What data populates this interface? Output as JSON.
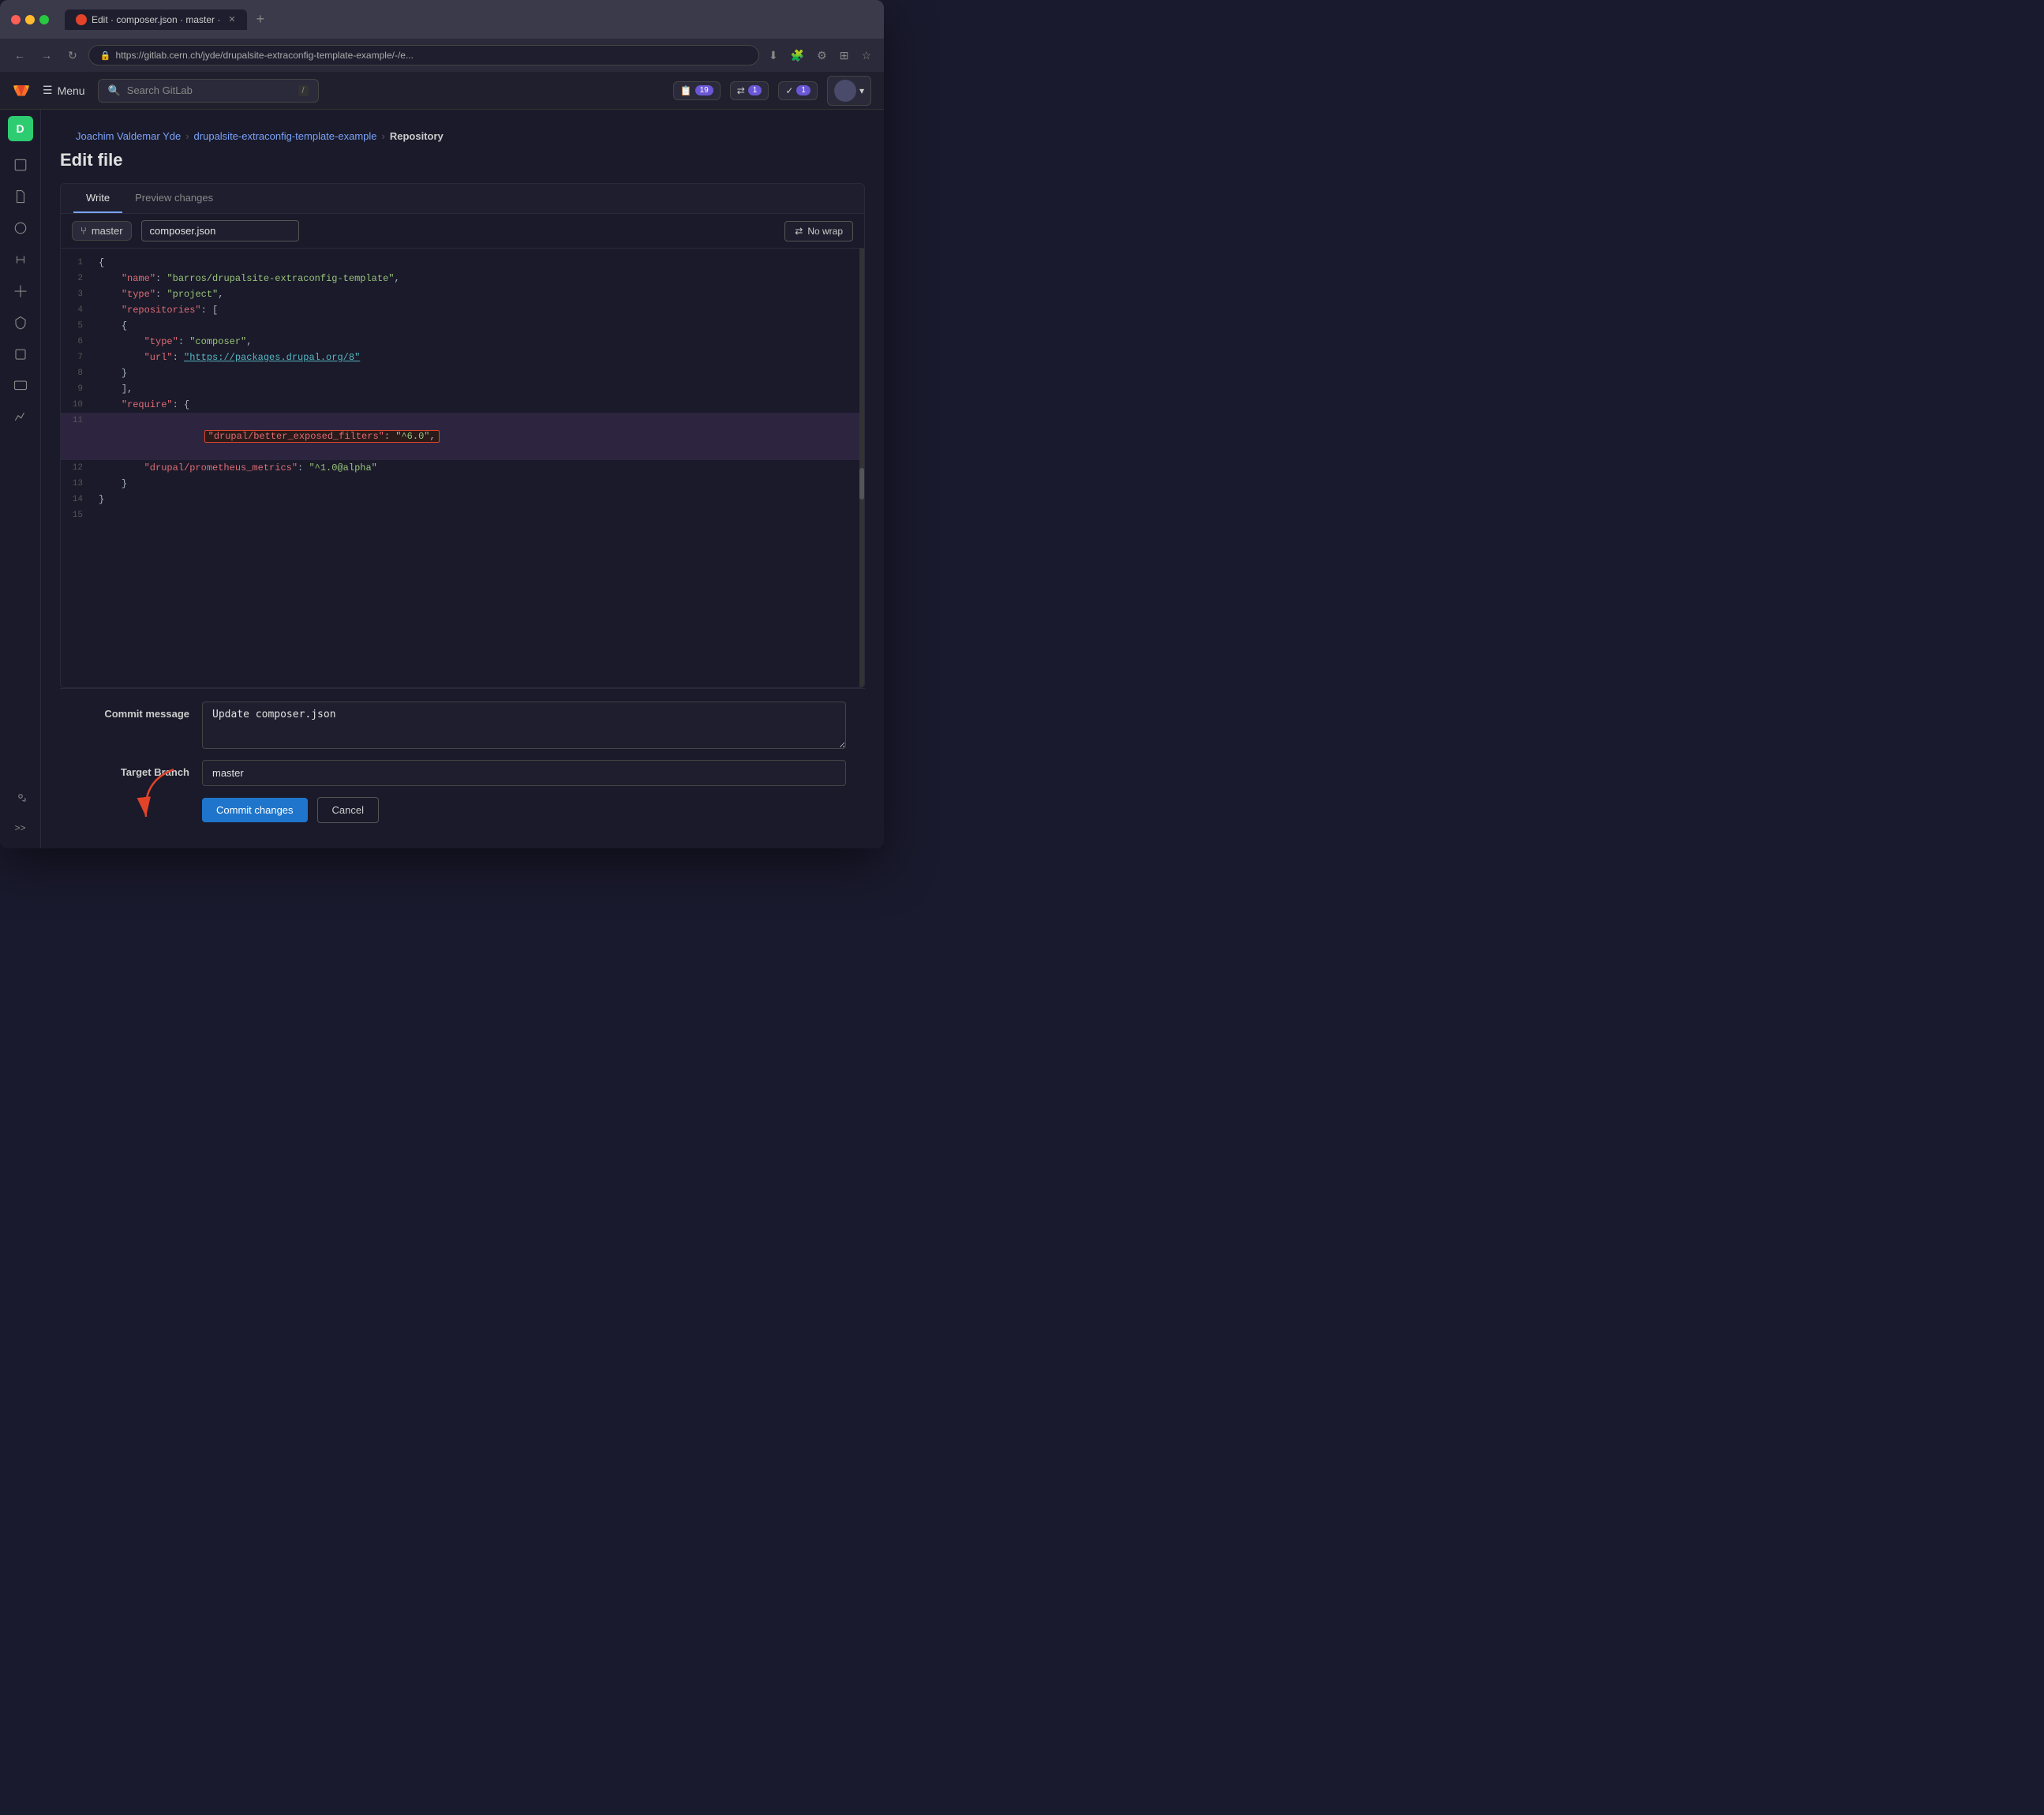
{
  "browser": {
    "tab_title": "Edit · composer.json · master ·",
    "url": "https://gitlab.cern.ch/jyde/drupalsite-extraconfig-template-example/-/e...",
    "new_tab_label": "+"
  },
  "header": {
    "logo_icon": "gitlab-logo",
    "menu_label": "Menu",
    "search_placeholder": "Search GitLab",
    "search_shortcut": "/",
    "todos_count": "19",
    "mr_count": "1",
    "issues_count": "1"
  },
  "breadcrumb": {
    "user": "Joachim Valdemar Yde",
    "repo": "drupalsite-extraconfig-template-example",
    "section": "Repository"
  },
  "page": {
    "title": "Edit file"
  },
  "edit_file": {
    "tabs": [
      "Write",
      "Preview changes"
    ],
    "active_tab": "Write",
    "branch": "master",
    "filename": "composer.json",
    "nowrap_label": "No wrap"
  },
  "code": {
    "lines": [
      {
        "num": 1,
        "text": "{",
        "highlighted": false
      },
      {
        "num": 2,
        "text": "    \"name\": \"barros/drupalsite-extraconfig-template\",",
        "highlighted": false
      },
      {
        "num": 3,
        "text": "    \"type\": \"project\",",
        "highlighted": false
      },
      {
        "num": 4,
        "text": "    \"repositories\": [",
        "highlighted": false
      },
      {
        "num": 5,
        "text": "    {",
        "highlighted": false
      },
      {
        "num": 6,
        "text": "        \"type\": \"composer\",",
        "highlighted": false
      },
      {
        "num": 7,
        "text": "        \"url\": \"https://packages.drupal.org/8\"",
        "highlighted": false
      },
      {
        "num": 8,
        "text": "    }",
        "highlighted": false
      },
      {
        "num": 9,
        "text": "    ],",
        "highlighted": false
      },
      {
        "num": 10,
        "text": "    \"require\": {",
        "highlighted": false
      },
      {
        "num": 11,
        "text": "        \"drupal/better_exposed_filters\": \"^6.0\",",
        "highlighted": true,
        "boxed": true
      },
      {
        "num": 12,
        "text": "        \"drupal/prometheus_metrics\": \"^1.0@alpha\"",
        "highlighted": false
      },
      {
        "num": 13,
        "text": "    }",
        "highlighted": false
      },
      {
        "num": 14,
        "text": "}",
        "highlighted": false
      },
      {
        "num": 15,
        "text": "",
        "highlighted": false
      }
    ]
  },
  "commit": {
    "message_label": "Commit message",
    "message_value": "Update composer.json",
    "target_branch_label": "Target Branch",
    "target_branch_value": "master",
    "commit_btn": "Commit changes",
    "cancel_btn": "Cancel"
  },
  "sidebar": {
    "project_initial": "D",
    "icons": [
      "repo-icon",
      "file-icon",
      "branch-icon",
      "merge-request-icon",
      "rocket-icon",
      "shield-icon",
      "packages-icon",
      "monitor-icon",
      "chart-icon",
      "settings-icon"
    ],
    "collapse_label": ">>"
  },
  "colors": {
    "accent": "#1f75cb",
    "gitlab_orange": "#e24329",
    "highlight_border": "#e24329"
  }
}
